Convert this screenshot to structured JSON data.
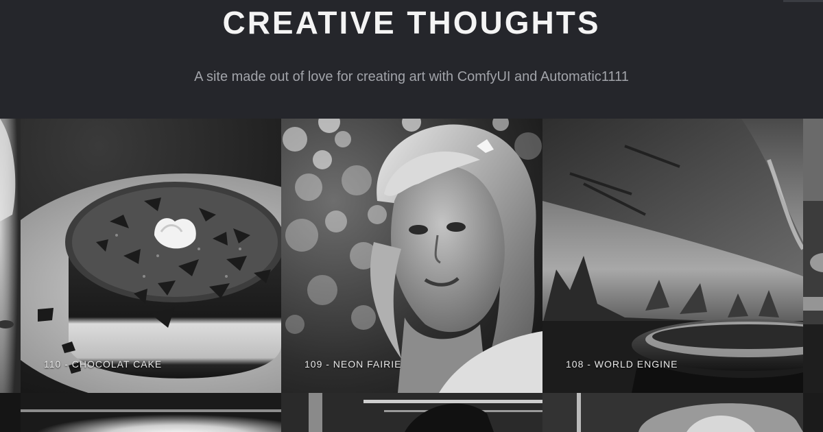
{
  "header": {
    "title": "CREATIVE THOUGHTS",
    "tagline": "A site made out of love for creating art with ComfyUI and Automatic1111"
  },
  "gallery": {
    "tiles": [
      {
        "caption": "110 - CHOCOLAT CAKE"
      },
      {
        "caption": "109 - NEON FAIRIE"
      },
      {
        "caption": "108 - WORLD ENGINE"
      }
    ]
  }
}
